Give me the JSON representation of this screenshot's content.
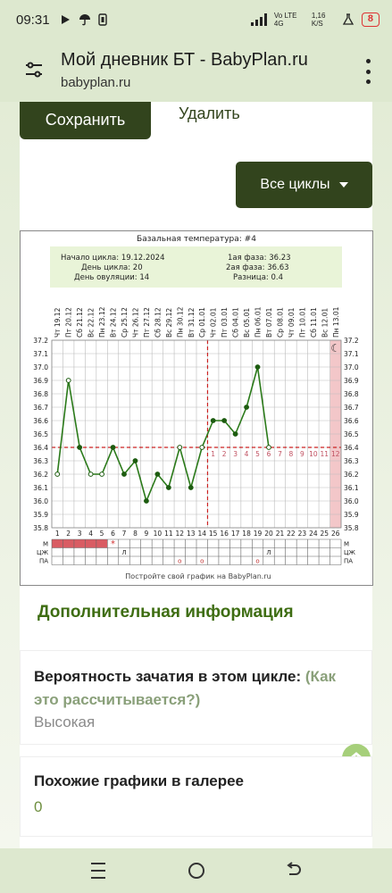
{
  "status_bar": {
    "time": "09:31",
    "network": "Vo LTE 4G",
    "speed": "1,16 K/S",
    "battery": "8",
    "icons": [
      "youtube-icon",
      "umbrella-icon",
      "phone-storage-icon",
      "signal-icon",
      "lab-flask-icon",
      "battery-icon"
    ]
  },
  "browser": {
    "title": "Мой дневник БТ - BabyPlan.ru",
    "host": "babyplan.ru",
    "icons": [
      "tune-icon",
      "more-vert-icon"
    ]
  },
  "actions": {
    "save_label": "Сохранить",
    "delete_label": "Удалить",
    "all_cycles_label": "Все циклы"
  },
  "chart_data": {
    "type": "line",
    "title": "Базальная температура: #4",
    "info": {
      "cycle_start": "Начало цикла: 19.12.2024",
      "cycle_day": "День цикла: 20",
      "ovulation_day": "День овуляции: 14",
      "phase1": "1ая фаза: 36.23",
      "phase2": "2ая фаза: 36.63",
      "difference": "Разница: 0.4"
    },
    "dates": [
      "Чт 19.12",
      "Пт 20.12",
      "Сб 21.12",
      "Вс 22.12",
      "Пн 23.12",
      "Вт 24.12",
      "Ср 25.12",
      "Чт 26.12",
      "Пт 27.12",
      "Сб 28.12",
      "Вс 29.12",
      "Пн 30.12",
      "Вт 31.12",
      "Ср 01.01",
      "Чт 02.01",
      "Пт 03.01",
      "Сб 04.01",
      "Вс 05.01",
      "Пн 06.01",
      "Вт 07.01",
      "Ср 08.01",
      "Чт 09.01",
      "Пт 10.01",
      "Сб 11.01",
      "Вс 12.01",
      "Пн 13.01"
    ],
    "days": [
      1,
      2,
      3,
      4,
      5,
      6,
      7,
      8,
      9,
      10,
      11,
      12,
      13,
      14,
      15,
      16,
      17,
      18,
      19,
      20,
      21,
      22,
      23,
      24,
      25,
      26
    ],
    "temperatures": [
      36.2,
      36.9,
      36.4,
      36.2,
      36.2,
      36.4,
      36.2,
      36.3,
      36.0,
      36.2,
      36.1,
      36.4,
      36.1,
      36.4,
      36.6,
      36.6,
      36.5,
      36.7,
      37.0,
      36.4
    ],
    "open_markers_days": [
      1,
      2,
      4,
      5,
      12,
      14,
      20
    ],
    "y_ticks": [
      "37.2",
      "37.1",
      "37.0",
      "36.9",
      "36.8",
      "36.7",
      "36.6",
      "36.5",
      "36.4",
      "36.3",
      "36.2",
      "36.1",
      "36.0",
      "35.9",
      "35.8"
    ],
    "ylim": [
      35.8,
      37.2
    ],
    "coverline": 36.4,
    "ovulation_day": 14,
    "luteal_numbers": [
      "1",
      "2",
      "3",
      "4",
      "5",
      "6",
      "7",
      "8",
      "9",
      "10",
      "11",
      "12"
    ],
    "current_day": 26,
    "row_labels": [
      "М",
      "ЦЖ",
      "ПА"
    ],
    "menstruation_days": 5,
    "marks": {
      "star_day": 6,
      "star_symbol": "*",
      "mucus": [
        {
          "day": 7,
          "symbol": "Л"
        },
        {
          "day": 20,
          "symbol": "Л"
        }
      ],
      "pa": [
        {
          "day": 12,
          "symbol": "о"
        },
        {
          "day": 14,
          "symbol": "о"
        },
        {
          "day": 19,
          "symbol": "о"
        }
      ]
    },
    "footer": "Постройте свой график на BabyPlan.ru",
    "colors": {
      "line": "#2b7a1a",
      "coverline": "#cc2222",
      "menstruation": "#d95c63",
      "today": "#f3c7c9"
    },
    "grid": true
  },
  "info": {
    "title": "Дополнительная информация",
    "conception_question": "Вероятность зачатия в этом цикле:",
    "conception_link": "(Как это рассчитывается?)",
    "conception_value": "Высокая",
    "similar_label": "Похожие графики в галерее",
    "similar_value": "0"
  },
  "nav": {
    "icons": [
      "recent-apps-icon",
      "home-icon",
      "back-icon"
    ]
  }
}
